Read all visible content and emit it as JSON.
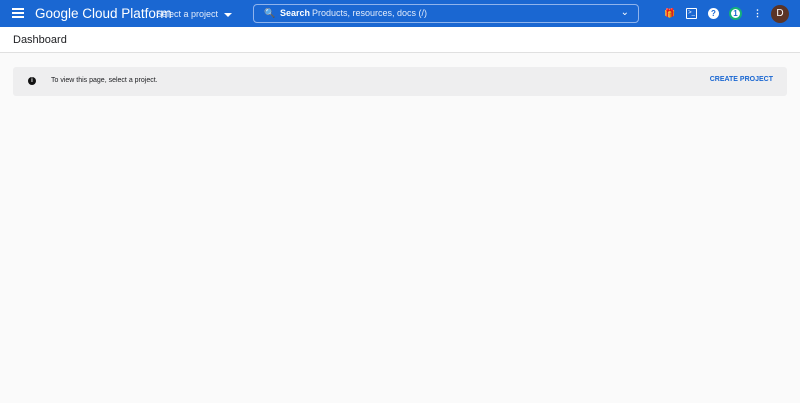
{
  "topbar": {
    "brand": "Google Cloud Platform",
    "project_selector": "Select a project",
    "search_label": "Search",
    "search_placeholder": "Products, resources, docs (/)",
    "notification_count": "1",
    "avatar_initial": "D",
    "accent": "#1a67d2"
  },
  "header": {
    "title": "Dashboard"
  },
  "banner": {
    "message": "To view this page, select a project.",
    "action": "CREATE PROJECT"
  }
}
